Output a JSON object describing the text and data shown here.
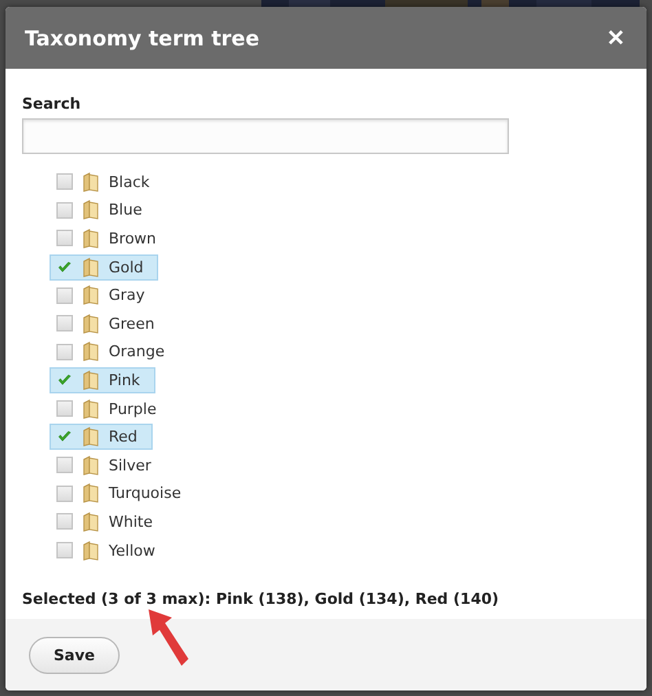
{
  "dialog": {
    "title": "Taxonomy term tree",
    "close": "✕"
  },
  "search": {
    "label": "Search"
  },
  "terms": [
    {
      "label": "Black",
      "checked": false
    },
    {
      "label": "Blue",
      "checked": false
    },
    {
      "label": "Brown",
      "checked": false
    },
    {
      "label": "Gold",
      "checked": true
    },
    {
      "label": "Gray",
      "checked": false
    },
    {
      "label": "Green",
      "checked": false
    },
    {
      "label": "Orange",
      "checked": false
    },
    {
      "label": "Pink",
      "checked": true
    },
    {
      "label": "Purple",
      "checked": false
    },
    {
      "label": "Red",
      "checked": true
    },
    {
      "label": "Silver",
      "checked": false
    },
    {
      "label": "Turquoise",
      "checked": false
    },
    {
      "label": "White",
      "checked": false
    },
    {
      "label": "Yellow",
      "checked": false
    }
  ],
  "summary": "Selected (3 of 3 max): Pink (138), Gold (134), Red (140)",
  "buttons": [
    "Save"
  ]
}
